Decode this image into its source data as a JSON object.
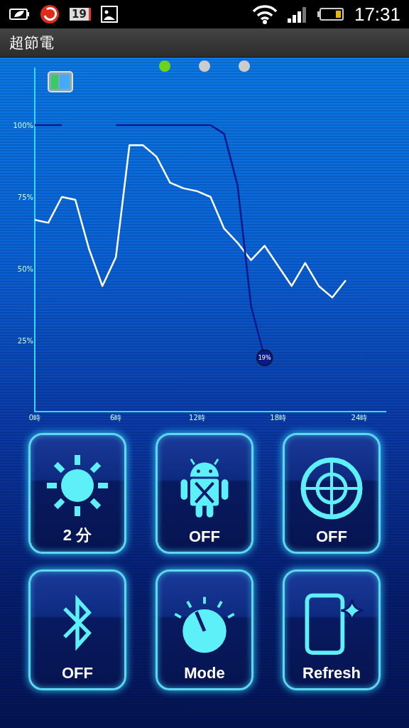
{
  "status_bar": {
    "calendar_day": "19",
    "time": "17:31"
  },
  "app_bar": {
    "title": "超節電"
  },
  "pages": [
    {
      "selected": true
    },
    {
      "selected": false
    },
    {
      "selected": false
    }
  ],
  "chart": {
    "chart_data": {
      "type": "line",
      "x": [
        0,
        1,
        2,
        3,
        4,
        5,
        6,
        7,
        8,
        9,
        10,
        11,
        12,
        13,
        14,
        15,
        16,
        17,
        18,
        19,
        20,
        21,
        22,
        23
      ],
      "xlim": [
        0,
        26
      ],
      "ylim": [
        0,
        120
      ],
      "xticks": [
        {
          "value": 0,
          "label": "0時"
        },
        {
          "value": 6,
          "label": "6時"
        },
        {
          "value": 12,
          "label": "12時"
        },
        {
          "value": 18,
          "label": "18時"
        },
        {
          "value": 24,
          "label": "24時"
        }
      ],
      "yticks": [
        {
          "value": 25,
          "label": "25%"
        },
        {
          "value": 50,
          "label": "50%"
        },
        {
          "value": 75,
          "label": "75%"
        },
        {
          "value": 100,
          "label": "100%"
        }
      ],
      "series": [
        {
          "color": "#ffffff",
          "values": [
            67,
            66,
            75,
            74,
            57,
            44,
            54,
            93,
            93,
            89,
            80,
            78,
            77,
            75,
            64,
            59,
            53,
            58,
            51,
            44,
            52,
            44,
            40,
            46
          ]
        },
        {
          "color": "#0a1a8a",
          "values": [
            100,
            100,
            100,
            null,
            null,
            null,
            100,
            100,
            100,
            100,
            100,
            100,
            100,
            100,
            97,
            79,
            37,
            19,
            null,
            null,
            null,
            null,
            null,
            null
          ]
        }
      ],
      "annotations": [
        {
          "text": "19%"
        }
      ]
    }
  },
  "buttons": [
    {
      "kind": "sun",
      "label": "2 分"
    },
    {
      "kind": "android",
      "label": "OFF"
    },
    {
      "kind": "target",
      "label": "OFF"
    },
    {
      "kind": "bluetooth",
      "label": "OFF"
    },
    {
      "kind": "dial",
      "label": "Mode"
    },
    {
      "kind": "phone",
      "label": "Refresh"
    }
  ]
}
